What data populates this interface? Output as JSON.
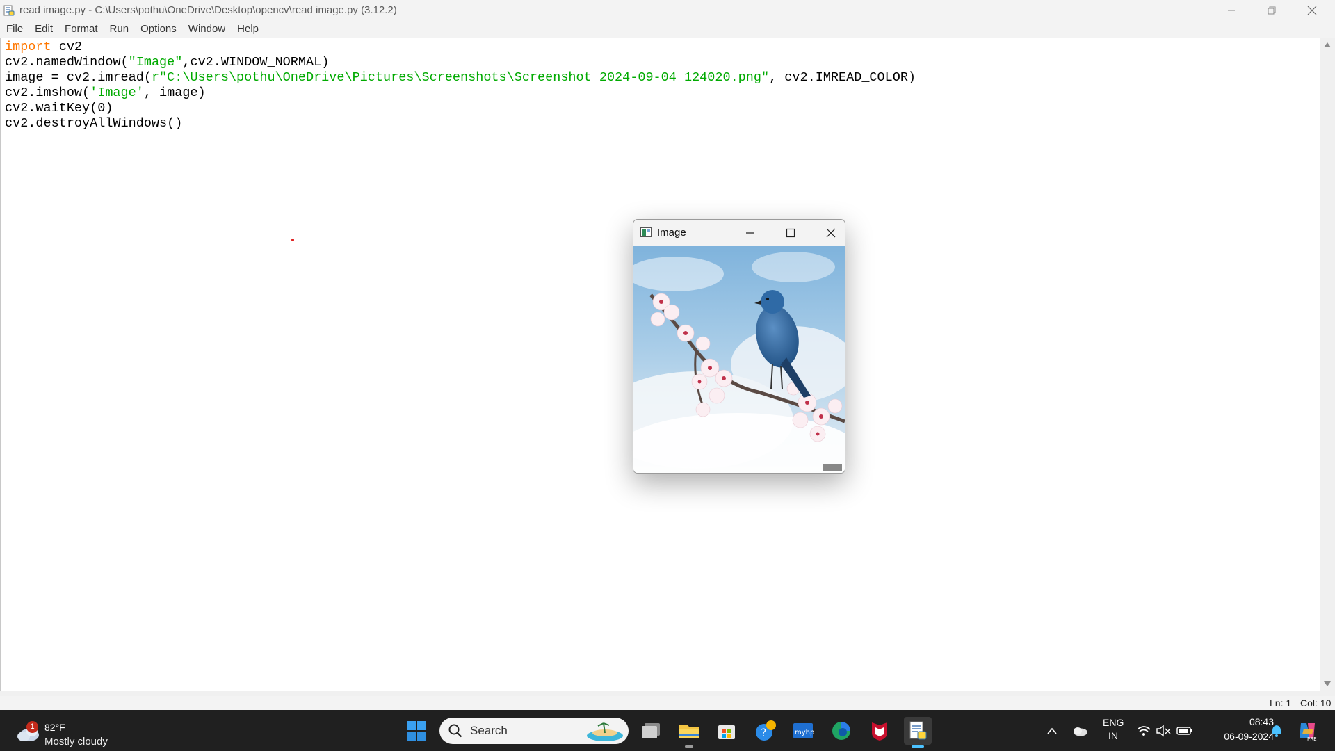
{
  "window": {
    "title": "read image.py - C:\\Users\\pothu\\OneDrive\\Desktop\\opencv\\read image.py (3.12.2)"
  },
  "menu": [
    "File",
    "Edit",
    "Format",
    "Run",
    "Options",
    "Window",
    "Help"
  ],
  "code": [
    [
      {
        "t": "import",
        "c": "kw"
      },
      {
        "t": " cv2"
      }
    ],
    [
      {
        "t": "cv2.namedWindow("
      },
      {
        "t": "\"Image\"",
        "c": "str"
      },
      {
        "t": ",cv2.WINDOW_NORMAL)"
      }
    ],
    [
      {
        "t": "image = cv2.imread("
      },
      {
        "t": "r\"C:\\Users\\pothu\\OneDrive\\Pictures\\Screenshots\\Screenshot 2024-09-04 124020.png\"",
        "c": "str"
      },
      {
        "t": ", cv2.IMREAD_COLOR)"
      }
    ],
    [
      {
        "t": "cv2.imshow("
      },
      {
        "t": "'Image'",
        "c": "str"
      },
      {
        "t": ", image)"
      }
    ],
    [
      {
        "t": "cv2.waitKey(0)"
      }
    ],
    [
      {
        "t": "cv2.destroyAllWindows()"
      }
    ]
  ],
  "status": {
    "line": "Ln: 1",
    "col": "Col: 10"
  },
  "image_window": {
    "title": "Image",
    "content_description_icon": "bird-on-blossom-branch-image"
  },
  "taskbar": {
    "weather": {
      "badge": "1",
      "temp": "82°F",
      "desc": "Mostly cloudy"
    },
    "search_label": "Search",
    "language": {
      "line1": "ENG",
      "line2": "IN"
    },
    "clock": {
      "time": "08:43",
      "date": "06-09-2024"
    },
    "icons": [
      "windows-start-icon",
      "task-view-icon",
      "file-explorer-icon",
      "microsoft-store-icon",
      "help-icon",
      "myhp-icon",
      "edge-icon",
      "mcafee-icon",
      "python-idle-icon"
    ]
  },
  "colors": {
    "keyword": "#ff7700",
    "string": "#00aa00",
    "taskbar": "#202020"
  }
}
